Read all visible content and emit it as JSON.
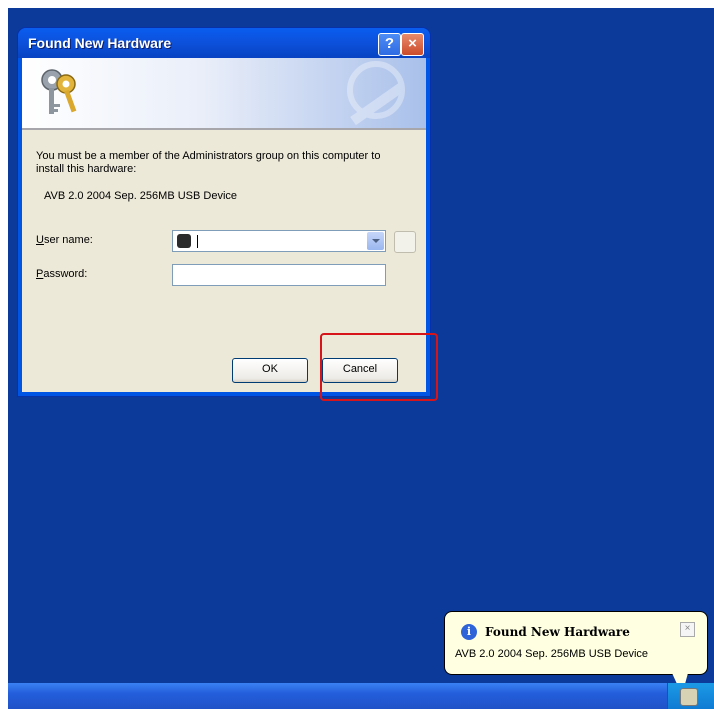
{
  "dialog": {
    "title": "Found New Hardware",
    "help_glyph": "?",
    "close_glyph": "×",
    "message": "You must be a member of the Administrators group on this computer to install this hardware:",
    "device_name": "AVB 2.0 2004 Sep. 256MB USB Device",
    "user_label_accel": "U",
    "user_label_rest": "ser name:",
    "password_label_accel": "P",
    "password_label_rest": "assword:",
    "username_value": "",
    "password_value": "",
    "ok_label": "OK",
    "cancel_label": "Cancel"
  },
  "balloon": {
    "title": "Found New Hardware",
    "body": "AVB 2.0 2004 Sep. 256MB USB Device",
    "info_glyph": "i",
    "close_glyph": "×"
  },
  "colors": {
    "desktop": "#0b3a9a",
    "highlight": "#d8141b",
    "balloon_bg": "#ffffe1",
    "titlebar": "#0c4fd8"
  },
  "icons": [
    "keys-icon",
    "help-icon",
    "close-icon",
    "user-icon",
    "dropdown-arrow-icon",
    "info-icon",
    "tray-hardware-icon"
  ]
}
